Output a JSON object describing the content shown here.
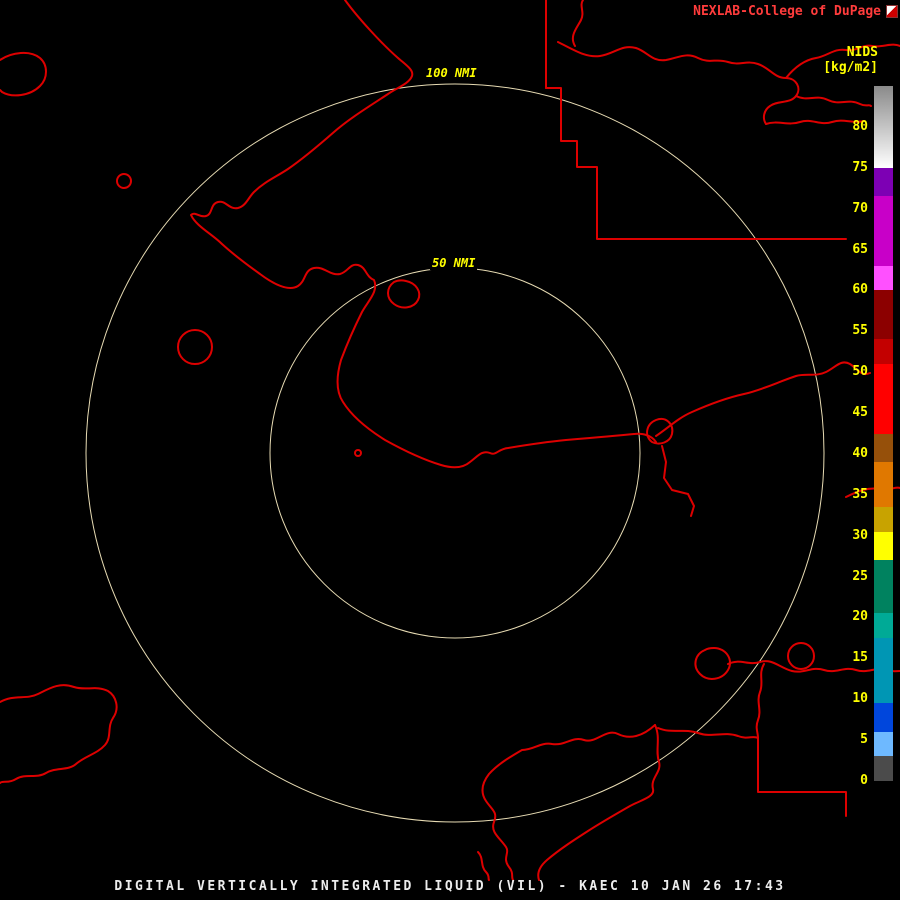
{
  "header": {
    "brand": "NEXLAB-College of DuPage"
  },
  "colorbar": {
    "title": "NIDS",
    "units": "[kg/m2]",
    "max": 85,
    "min": 0,
    "tick_values": [
      80,
      75,
      70,
      65,
      60,
      55,
      50,
      45,
      40,
      35,
      30,
      25,
      20,
      15,
      10,
      5,
      0
    ],
    "segments": [
      {
        "from": 85,
        "to": 75,
        "color": "#ffffff",
        "gradient_from": "#8a8a8a"
      },
      {
        "from": 75,
        "to": 71.5,
        "color": "#7d00b4"
      },
      {
        "from": 71.5,
        "to": 63,
        "color": "#c800c8"
      },
      {
        "from": 63,
        "to": 60,
        "color": "#ff50ff"
      },
      {
        "from": 60,
        "to": 54,
        "color": "#8c0000"
      },
      {
        "from": 54,
        "to": 51,
        "color": "#c30000"
      },
      {
        "from": 51,
        "to": 42.5,
        "color": "#ff0000"
      },
      {
        "from": 42.5,
        "to": 39,
        "color": "#96500a"
      },
      {
        "from": 39,
        "to": 33.5,
        "color": "#e07800"
      },
      {
        "from": 33.5,
        "to": 30.5,
        "color": "#c8a300"
      },
      {
        "from": 30.5,
        "to": 27,
        "color": "#ffff00"
      },
      {
        "from": 27,
        "to": 20.5,
        "color": "#00825f"
      },
      {
        "from": 20.5,
        "to": 17.5,
        "color": "#00aa96"
      },
      {
        "from": 17.5,
        "to": 9.5,
        "color": "#0096b4"
      },
      {
        "from": 9.5,
        "to": 6,
        "color": "#0046dc"
      },
      {
        "from": 6,
        "to": 3,
        "color": "#6eb9ff"
      },
      {
        "from": 3,
        "to": 0,
        "color": "#4b4b4b"
      }
    ]
  },
  "map": {
    "ring_labels": {
      "outer": "100 NMI",
      "inner": "50 NMI"
    },
    "ring_color": "#e8dcb4",
    "outline_color": "#dd0000",
    "label_color": "#ffff00"
  },
  "footer": {
    "caption": "DIGITAL VERTICALLY INTEGRATED LIQUID (VIL) - KAEC 10 JAN 26 17:43"
  }
}
